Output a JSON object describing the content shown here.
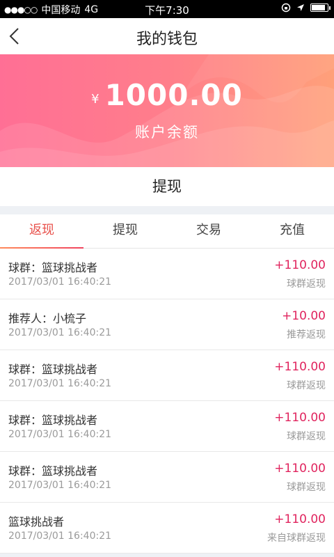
{
  "status_bar": {
    "signal": "●●●○○",
    "carrier": "中国移动",
    "network": "4G",
    "time": "下午7:30"
  },
  "nav": {
    "title": "我的钱包"
  },
  "wallet": {
    "currency": "¥",
    "balance": "1000.00",
    "balance_label": "账户余额",
    "withdraw_label": "提现"
  },
  "tabs": [
    {
      "label": "返现",
      "active": true
    },
    {
      "label": "提现",
      "active": false
    },
    {
      "label": "交易",
      "active": false
    },
    {
      "label": "充值",
      "active": false
    }
  ],
  "records": [
    {
      "title": "球群：篮球挑战者",
      "time": "2017/03/01 16:40:21",
      "amount": "+110.00",
      "type": "球群返现"
    },
    {
      "title": "推荐人：小梳子",
      "time": "2017/03/01 16:40:21",
      "amount": "+10.00",
      "type": "推荐返现"
    },
    {
      "title": "球群：篮球挑战者",
      "time": "2017/03/01 16:40:21",
      "amount": "+110.00",
      "type": "球群返现"
    },
    {
      "title": "球群：篮球挑战者",
      "time": "2017/03/01 16:40:21",
      "amount": "+110.00",
      "type": "球群返现"
    },
    {
      "title": "球群：篮球挑战者",
      "time": "2017/03/01 16:40:21",
      "amount": "+110.00",
      "type": "球群返现"
    },
    {
      "title": "篮球挑战者",
      "time": "2017/03/01 16:40:21",
      "amount": "+110.00",
      "type": "来自球群返现"
    }
  ],
  "colors": {
    "accent": "#e8504a",
    "amount": "#e0245e",
    "banner_start": "#ff6f95",
    "banner_end": "#ffa07a"
  }
}
